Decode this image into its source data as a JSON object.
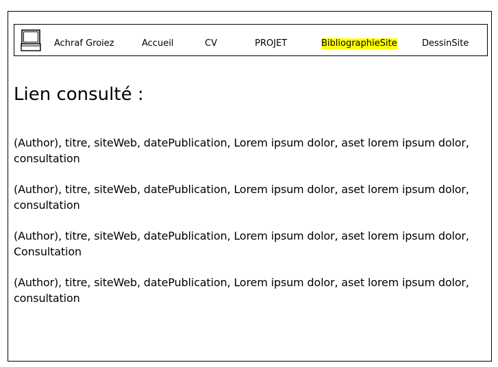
{
  "nav": {
    "brand": "Achraf Groiez",
    "items": [
      {
        "label": "Accueil"
      },
      {
        "label": "CV"
      },
      {
        "label": "PROJET"
      },
      {
        "label": "BibliographieSite",
        "active": true
      },
      {
        "label": "DessinSite"
      }
    ],
    "highlight_color": "#ffff00"
  },
  "main": {
    "title": "Lien consulté :",
    "references": [
      {
        "text": "(Author), titre, siteWeb, datePublication, Lorem ipsum dolor, aset lorem ipsum dolor, consultation"
      },
      {
        "text": "(Author), titre, siteWeb, datePublication, Lorem ipsum dolor, aset lorem ipsum dolor, consultation"
      },
      {
        "text": "(Author), titre, siteWeb, datePublication, Lorem ipsum dolor, aset lorem ipsum dolor, Consultation"
      },
      {
        "text": "(Author), titre, siteWeb, datePublication, Lorem ipsum dolor, aset lorem ipsum dolor, consultation"
      }
    ]
  },
  "icons": {
    "logo": "computer-icon"
  }
}
